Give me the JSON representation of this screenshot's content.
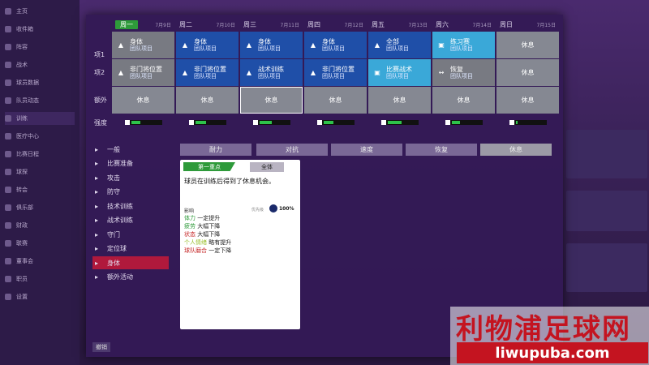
{
  "sidebar": {
    "items": [
      {
        "label": "主页"
      },
      {
        "label": "收件箱"
      },
      {
        "label": "阵容"
      },
      {
        "label": "战术"
      },
      {
        "label": "球员数据"
      },
      {
        "label": "队员动态"
      },
      {
        "label": "训练"
      },
      {
        "label": "医疗中心"
      },
      {
        "label": "比赛日程"
      },
      {
        "label": "球探"
      },
      {
        "label": "转会"
      },
      {
        "label": "俱乐部"
      },
      {
        "label": "财政"
      },
      {
        "label": "联赛"
      },
      {
        "label": "董事会"
      },
      {
        "label": "职员"
      },
      {
        "label": "设置"
      }
    ]
  },
  "schedule": {
    "days": [
      {
        "day": "周一",
        "date": "7月9日",
        "selected": true
      },
      {
        "day": "周二",
        "date": "7月10日"
      },
      {
        "day": "周三",
        "date": "7月11日"
      },
      {
        "day": "周四",
        "date": "7月12日"
      },
      {
        "day": "周五",
        "date": "7月13日"
      },
      {
        "day": "周六",
        "date": "7月14日"
      },
      {
        "day": "周日",
        "date": "7月15日"
      }
    ],
    "row_labels": {
      "item1": "项1",
      "item2": "项2",
      "extra": "额外",
      "intensity": "强度"
    },
    "item1": [
      {
        "title": "身体",
        "sub": "团队项目",
        "style": "grey",
        "icon": "person-icon"
      },
      {
        "title": "身体",
        "sub": "团队项目",
        "style": "blue",
        "icon": "person-icon"
      },
      {
        "title": "身体",
        "sub": "团队项目",
        "style": "blue",
        "icon": "person-icon"
      },
      {
        "title": "身体",
        "sub": "团队项目",
        "style": "blue",
        "icon": "person-icon"
      },
      {
        "title": "全部",
        "sub": "团队项目",
        "style": "blue",
        "icon": "person-icon"
      },
      {
        "title": "练习赛",
        "sub": "团队项目",
        "style": "cyan",
        "icon": "match-icon"
      },
      {
        "title": "休息",
        "sub": "",
        "style": "rest",
        "icon": ""
      }
    ],
    "item2": [
      {
        "title": "非门将位置",
        "sub": "团队项目",
        "style": "grey",
        "icon": "person-icon"
      },
      {
        "title": "非门将位置",
        "sub": "团队项目",
        "style": "blue",
        "icon": "person-icon"
      },
      {
        "title": "战术训练",
        "sub": "团队项目",
        "style": "blue",
        "icon": "person-icon"
      },
      {
        "title": "非门将位置",
        "sub": "团队项目",
        "style": "blue",
        "icon": "person-icon"
      },
      {
        "title": "比赛战术",
        "sub": "团队项目",
        "style": "cyan",
        "icon": "match-icon"
      },
      {
        "title": "恢复",
        "sub": "团队项目",
        "style": "grey",
        "icon": "recovery-icon"
      },
      {
        "title": "休息",
        "sub": "",
        "style": "rest",
        "icon": ""
      }
    ],
    "extra": [
      "休息",
      "休息",
      "休息",
      "休息",
      "休息",
      "休息",
      "休息"
    ],
    "intensity": [
      0.3,
      0.35,
      0.4,
      0.32,
      0.45,
      0.25,
      0.05
    ]
  },
  "categories": [
    {
      "label": "一般",
      "icon": "person-icon"
    },
    {
      "label": "比赛准备",
      "icon": "clipboard-icon"
    },
    {
      "label": "攻击",
      "icon": "attack-icon"
    },
    {
      "label": "防守",
      "icon": "defend-icon"
    },
    {
      "label": "技术训练",
      "icon": "technique-icon"
    },
    {
      "label": "战术训练",
      "icon": "tactics-icon"
    },
    {
      "label": "守门",
      "icon": "goalkeeper-icon"
    },
    {
      "label": "定位球",
      "icon": "setpiece-icon"
    },
    {
      "label": "身体",
      "icon": "physical-icon",
      "active": true
    },
    {
      "label": "额外活动",
      "icon": "extra-icon"
    }
  ],
  "tabs": [
    "耐力",
    "对抗",
    "速度",
    "恢复",
    "休息"
  ],
  "detail": {
    "focus_tag": "第一重点",
    "scope": "全体",
    "description": "球员在训练后得到了休息机会。",
    "impact_label": "影响",
    "priority_label": "优先级",
    "priority_value": "100%",
    "effects": [
      {
        "name": "体力",
        "value": "一定提升",
        "color": "#2e9a3a"
      },
      {
        "name": "疲劳",
        "value": "大幅下降",
        "color": "#2e9a3a"
      },
      {
        "name": "状态",
        "value": "大幅下降",
        "color": "#c62828"
      },
      {
        "name": "个人情绪",
        "value": "略有提升",
        "color": "#9bbf2e"
      },
      {
        "name": "球队磨合",
        "value": "一定下降",
        "color": "#c62828"
      }
    ]
  },
  "footer": {
    "cancel": "撤销"
  },
  "watermark": {
    "title": "利物浦足球网",
    "url": "liwupuba.com"
  }
}
